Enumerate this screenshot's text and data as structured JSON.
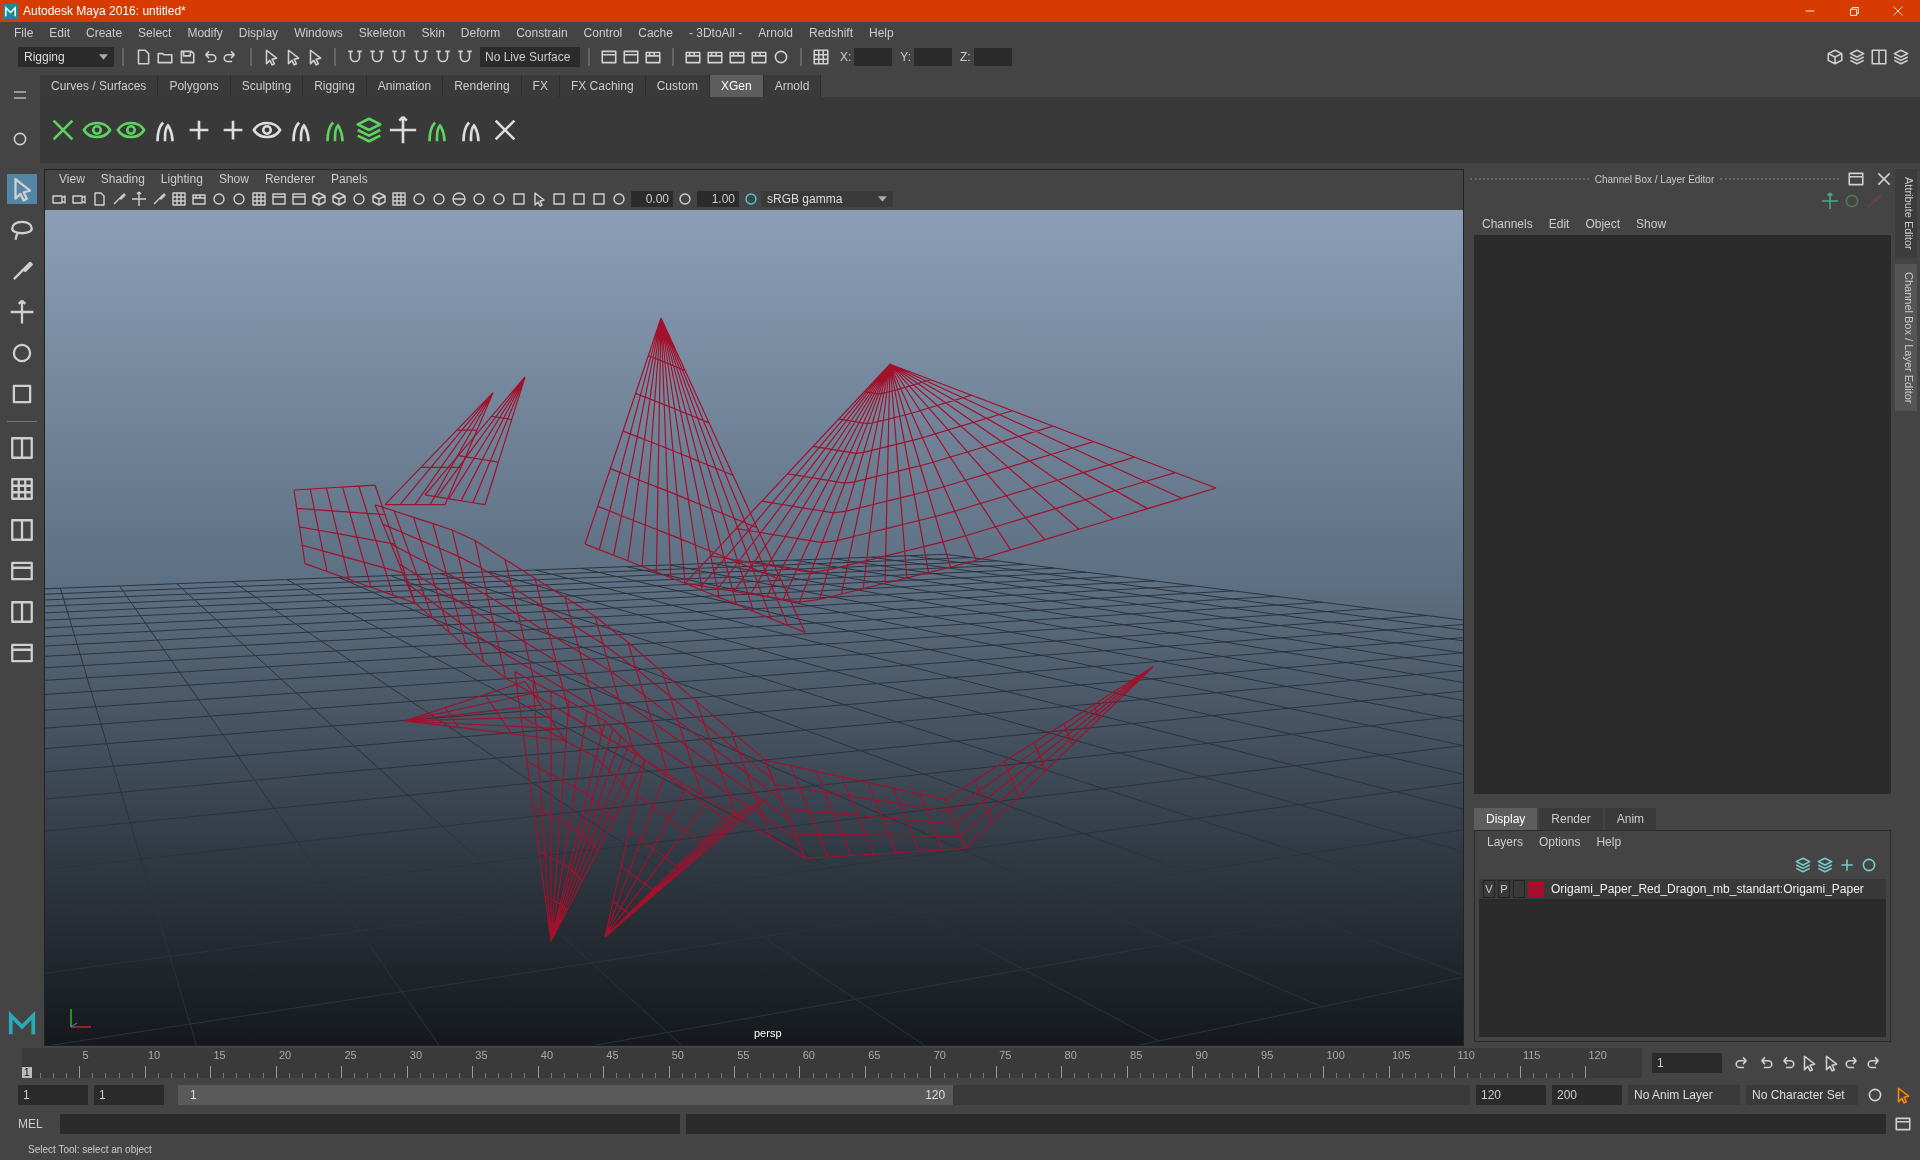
{
  "window": {
    "title": "Autodesk Maya 2016: untitled*"
  },
  "menu_bar": [
    "File",
    "Edit",
    "Create",
    "Select",
    "Modify",
    "Display",
    "Windows",
    "Skeleton",
    "Skin",
    "Deform",
    "Constrain",
    "Control",
    "Cache",
    "- 3DtoAll -",
    "Arnold",
    "Redshift",
    "Help"
  ],
  "status_line": {
    "mode": "Rigging",
    "live_surface": "No Live Surface",
    "coord_labels": [
      "X:",
      "Y:",
      "Z:"
    ]
  },
  "shelf_tabs": [
    {
      "label": "Curves / Surfaces",
      "selected": false
    },
    {
      "label": "Polygons",
      "selected": false
    },
    {
      "label": "Sculpting",
      "selected": false
    },
    {
      "label": "Rigging",
      "selected": false
    },
    {
      "label": "Animation",
      "selected": false
    },
    {
      "label": "Rendering",
      "selected": false
    },
    {
      "label": "FX",
      "selected": false
    },
    {
      "label": "FX Caching",
      "selected": false
    },
    {
      "label": "Custom",
      "selected": false
    },
    {
      "label": "XGen",
      "selected": true
    },
    {
      "label": "Arnold",
      "selected": false
    }
  ],
  "viewport": {
    "menu": [
      "View",
      "Shading",
      "Lighting",
      "Show",
      "Renderer",
      "Panels"
    ],
    "exposure": "0.00",
    "gamma": "1.00",
    "color_space": "sRGB gamma",
    "camera_label": "persp"
  },
  "channel_box": {
    "title": "Channel Box / Layer Editor",
    "menu": [
      "Channels",
      "Edit",
      "Object",
      "Show"
    ]
  },
  "side_tabs": [
    "Attribute Editor",
    "Channel Box / Layer Editor"
  ],
  "layer_editor": {
    "tabs": [
      {
        "label": "Display",
        "selected": true
      },
      {
        "label": "Render",
        "selected": false
      },
      {
        "label": "Anim",
        "selected": false
      }
    ],
    "menu": [
      "Layers",
      "Options",
      "Help"
    ],
    "layers": [
      {
        "visible": "V",
        "playback": "P",
        "color": "#a3102c",
        "name": "Origami_Paper_Red_Dragon_mb_standart:Origami_Paper"
      }
    ]
  },
  "timeline": {
    "start_label": "1",
    "ticks": [
      "5",
      "10",
      "15",
      "20",
      "25",
      "30",
      "35",
      "40",
      "45",
      "50",
      "55",
      "60",
      "65",
      "70",
      "75",
      "80",
      "85",
      "90",
      "95",
      "100",
      "105",
      "110",
      "115",
      "120"
    ],
    "current_frame": "1",
    "level": 0
  },
  "range": {
    "start": "1",
    "playback_start": "1",
    "slider_start": "1",
    "slider_end": "120",
    "playback_end": "120",
    "end": "200",
    "anim_layer": "No Anim Layer",
    "character_set": "No Character Set",
    "level": 0.6
  },
  "command_line": {
    "label": "MEL"
  },
  "help_line": "Select Tool: select an object"
}
